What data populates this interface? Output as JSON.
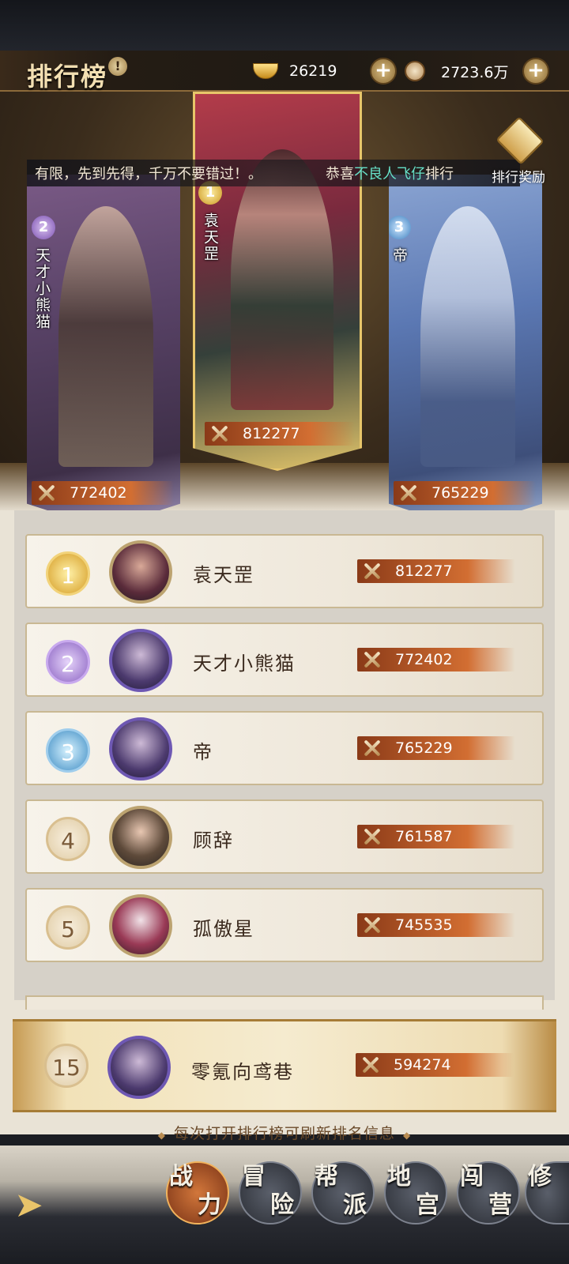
{
  "header": {
    "title": "排行榜",
    "gold": "26219",
    "coins": "2723.6万"
  },
  "marquee": {
    "text1": "有限，先到先得，千万不要错过！。",
    "text2_prefix": "恭喜",
    "text2_highlight": "不良人飞仔",
    "text2_suffix": "排行"
  },
  "reward": {
    "label": "排行奖励"
  },
  "podium": [
    {
      "rank": "2",
      "name": "天才小熊猫",
      "power": "772402"
    },
    {
      "rank": "1",
      "name": "袁天罡",
      "power": "812277"
    },
    {
      "rank": "3",
      "name": "帝",
      "power": "765229"
    }
  ],
  "ranking": [
    {
      "rank": "1",
      "name": "袁天罡",
      "power": "812277"
    },
    {
      "rank": "2",
      "name": "天才小熊猫",
      "power": "772402"
    },
    {
      "rank": "3",
      "name": "帝",
      "power": "765229"
    },
    {
      "rank": "4",
      "name": "顾辞",
      "power": "761587"
    },
    {
      "rank": "5",
      "name": "孤傲星",
      "power": "745535"
    }
  ],
  "my_rank": {
    "rank": "15",
    "name": "零氪向鸢巷",
    "power": "594274"
  },
  "hint": "每次打开排行榜可刷新排名信息",
  "tabs": [
    {
      "c1": "战",
      "c2": "力"
    },
    {
      "c1": "冒",
      "c2": "险"
    },
    {
      "c1": "帮",
      "c2": "派"
    },
    {
      "c1": "地",
      "c2": "宫"
    },
    {
      "c1": "闯",
      "c2": "营"
    },
    {
      "c1": "修",
      "c2": ""
    }
  ],
  "colors": {
    "accent": "#d26e32",
    "gold": "#e8c66a",
    "highlight_text": "#66e0c8"
  }
}
